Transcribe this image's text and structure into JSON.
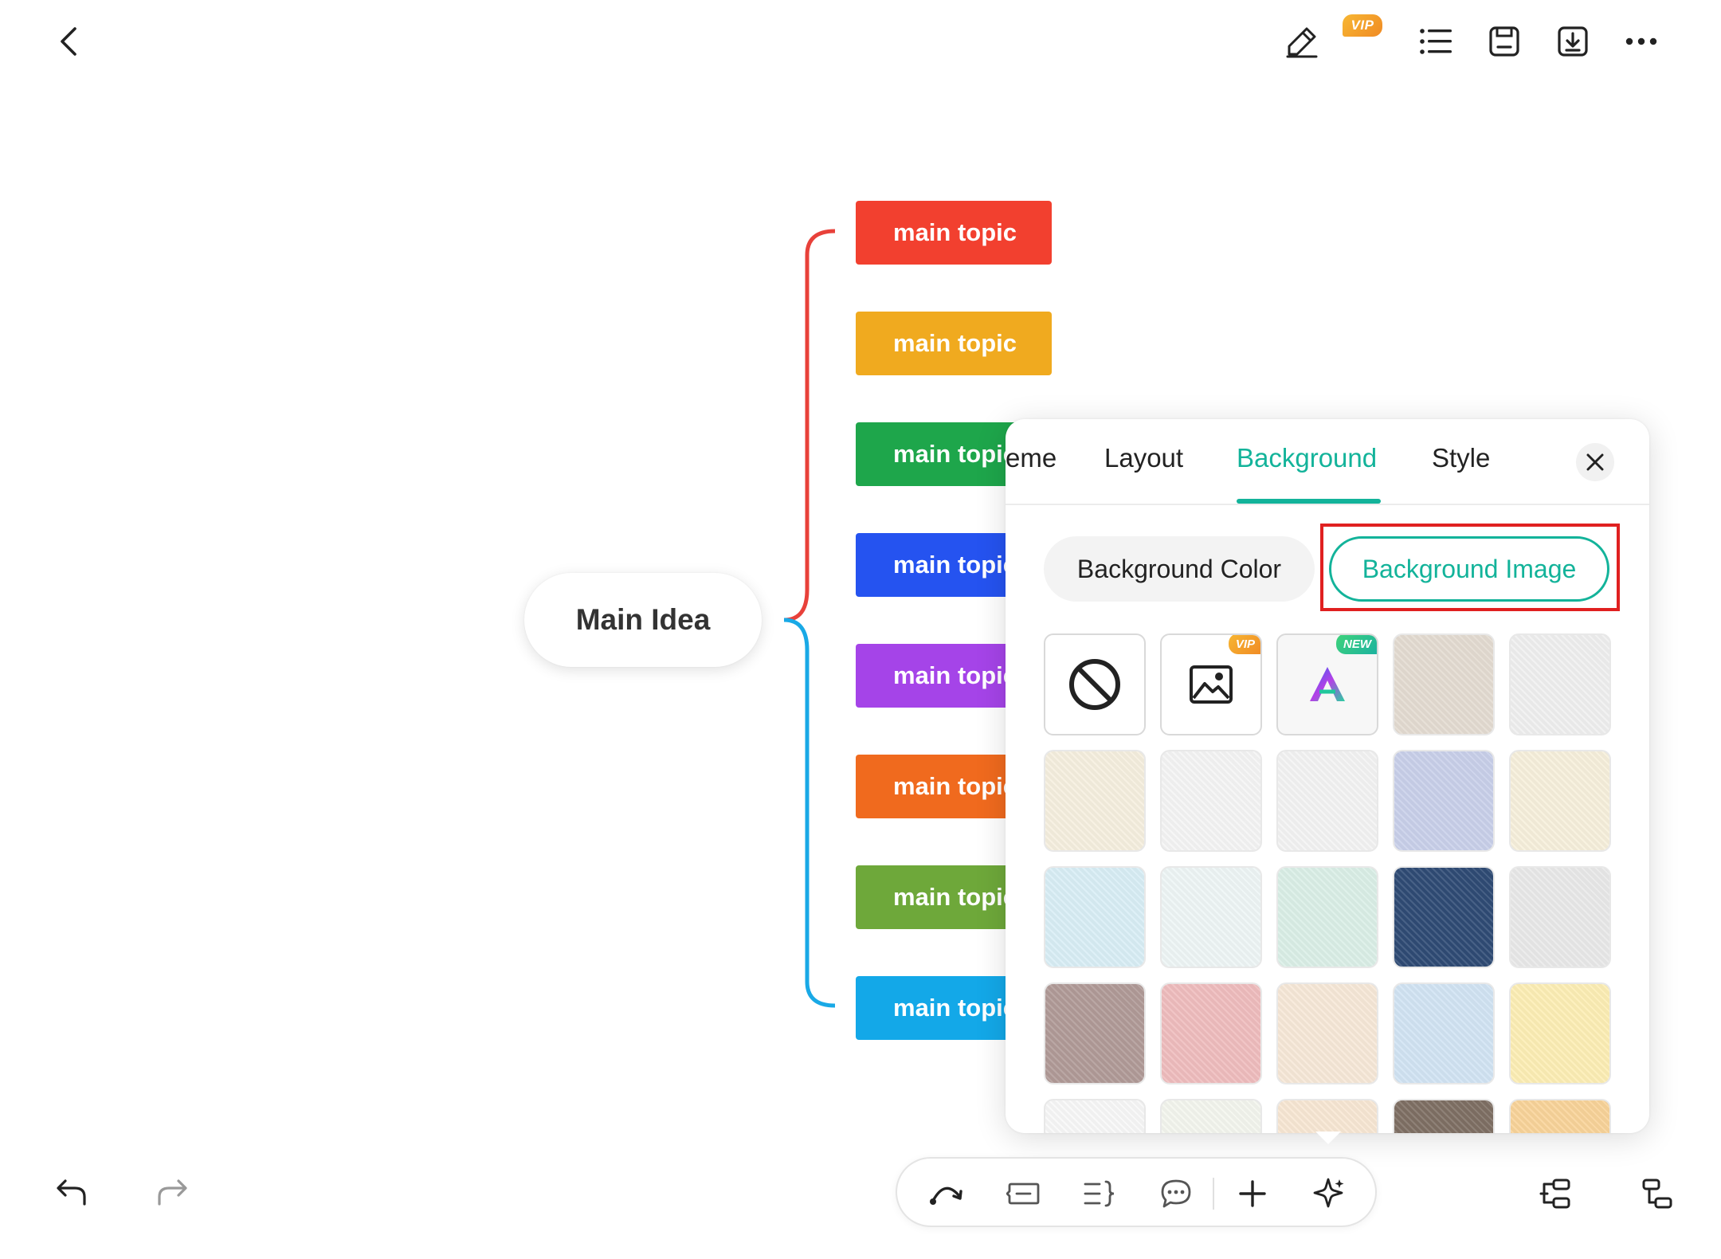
{
  "header": {
    "vip_badge": "VIP",
    "icons": [
      "back-icon",
      "pencil-icon",
      "outline-list-icon",
      "save-icon",
      "download-icon",
      "more-icon"
    ]
  },
  "mindmap": {
    "main_idea": "Main Idea",
    "topics": [
      {
        "label": "main topic",
        "color": "#f2402f"
      },
      {
        "label": "main topic",
        "color": "#f0aa1f"
      },
      {
        "label": "main topic",
        "color": "#1ea64b"
      },
      {
        "label": "main topic",
        "color": "#2553f0"
      },
      {
        "label": "main topic",
        "color": "#a544e8"
      },
      {
        "label": "main topic",
        "color": "#f06a1e"
      },
      {
        "label": "main topic",
        "color": "#6ea83a"
      },
      {
        "label": "main topic",
        "color": "#13a8e8"
      }
    ],
    "branch_colors": {
      "upper": "#e8413a",
      "lower": "#19a9e6"
    }
  },
  "panel": {
    "tabs": [
      {
        "label": "eme",
        "active": false
      },
      {
        "label": "Layout",
        "active": false
      },
      {
        "label": "Background",
        "active": true
      },
      {
        "label": "Style",
        "active": false
      }
    ],
    "segments": {
      "color_label": "Background Color",
      "image_label": "Background Image",
      "selected": "Background Image"
    },
    "accent": "#13b39a",
    "highlight_color": "#e02020",
    "tiles": [
      {
        "kind": "none-icon"
      },
      {
        "kind": "image-icon",
        "badge": "VIP"
      },
      {
        "kind": "ai-logo-icon",
        "badge": "NEW"
      },
      {
        "kind": "texture",
        "bg": "#e4dcd2"
      },
      {
        "kind": "texture",
        "bg": "#f0f0f0"
      },
      {
        "kind": "texture",
        "bg": "#f6efdf"
      },
      {
        "kind": "texture",
        "bg": "#f5f5f5"
      },
      {
        "kind": "texture",
        "bg": "#f4f4f4"
      },
      {
        "kind": "texture",
        "bg": "#c9d0ea"
      },
      {
        "kind": "texture",
        "bg": "#f7f0dc"
      },
      {
        "kind": "texture",
        "bg": "#d9eef6"
      },
      {
        "kind": "texture",
        "bg": "#eef6f6"
      },
      {
        "kind": "texture",
        "bg": "#dbefe7"
      },
      {
        "kind": "texture",
        "bg": "#2f4b75"
      },
      {
        "kind": "texture",
        "bg": "#e9e9e9"
      },
      {
        "kind": "texture",
        "bg": "#b19b98"
      },
      {
        "kind": "texture",
        "bg": "#efbdbe"
      },
      {
        "kind": "texture",
        "bg": "#f7e8d8"
      },
      {
        "kind": "texture",
        "bg": "#d2e4f4"
      },
      {
        "kind": "texture",
        "bg": "#fdeeb5"
      },
      {
        "kind": "texture",
        "bg": "#f8f8f8"
      },
      {
        "kind": "texture",
        "bg": "#f4f6ee"
      },
      {
        "kind": "texture",
        "bg": "#f8e7d4"
      },
      {
        "kind": "texture",
        "bg": "#7f7064"
      },
      {
        "kind": "texture",
        "bg": "#f9d49a"
      }
    ]
  },
  "footer": {
    "icons": [
      "undo-icon",
      "redo-icon",
      "relationship-icon",
      "callout-icon",
      "summary-icon",
      "comment-icon",
      "add-icon",
      "ai-sparkle-icon",
      "layout-left-icon",
      "layout-right-icon"
    ]
  }
}
